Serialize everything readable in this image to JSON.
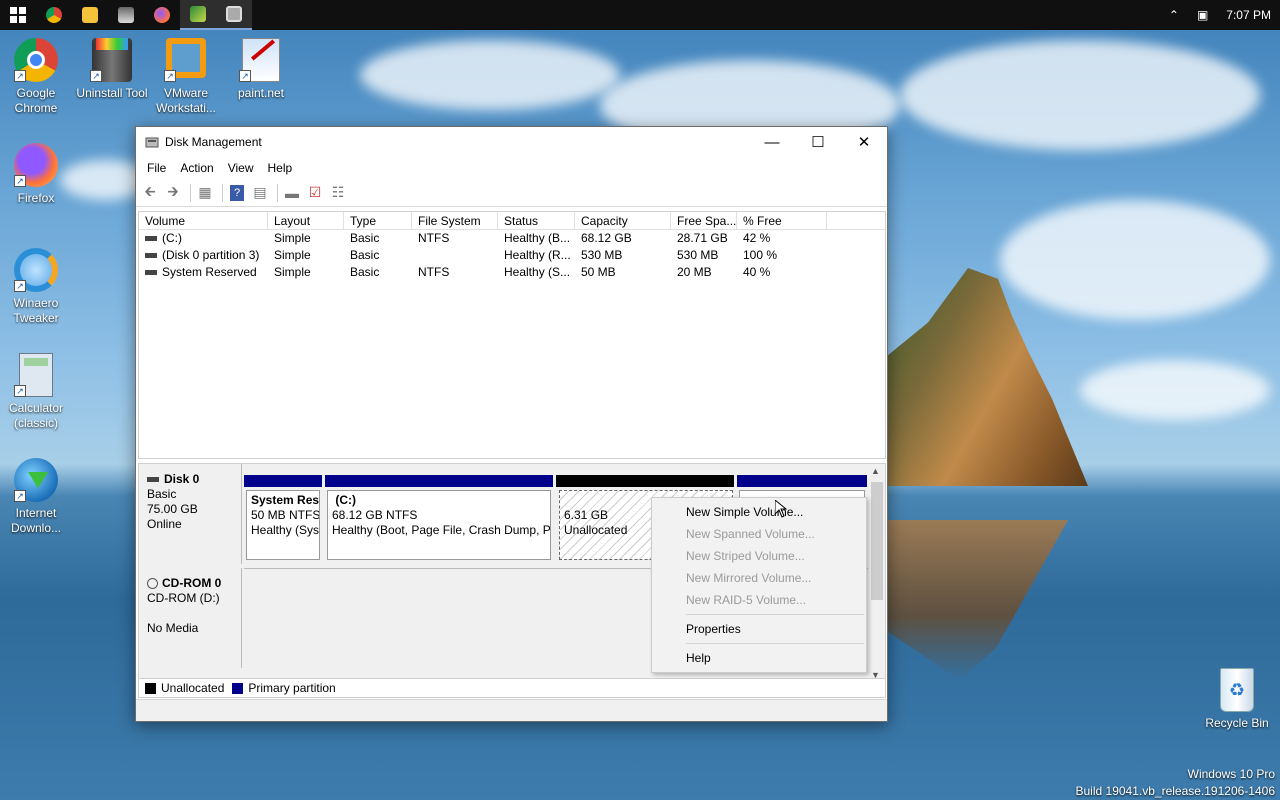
{
  "taskbar": {
    "apps": [
      {
        "icon": "windows-start-icon"
      },
      {
        "icon": "chrome-icon"
      },
      {
        "icon": "file-explorer-icon"
      },
      {
        "icon": "uninstall-tool-icon"
      },
      {
        "icon": "firefox-icon"
      },
      {
        "icon": "app-icon"
      },
      {
        "icon": "disk-management-icon"
      }
    ],
    "time": "7:07 PM"
  },
  "desktop": {
    "icons": [
      {
        "label": "Google Chrome",
        "icon": "chrome-icon"
      },
      {
        "label": "Uninstall Tool",
        "icon": "uninstall-tool-icon"
      },
      {
        "label": "VMware Workstati...",
        "icon": "vmware-icon"
      },
      {
        "label": "paint.net",
        "icon": "paintnet-icon"
      },
      {
        "label": "Firefox",
        "icon": "firefox-icon"
      },
      {
        "label": "Winaero Tweaker",
        "icon": "winaero-icon"
      },
      {
        "label": "Calculator (classic)",
        "icon": "calculator-icon"
      },
      {
        "label": "Internet Downlo...",
        "icon": "idm-icon"
      }
    ],
    "recycle_bin": "Recycle Bin",
    "watermark": {
      "line1": "Windows 10 Pro",
      "line2": "Build 19041.vb_release.191206-1406"
    }
  },
  "window": {
    "title": "Disk Management",
    "menu": [
      "File",
      "Action",
      "View",
      "Help"
    ],
    "columns": [
      "Volume",
      "Layout",
      "Type",
      "File System",
      "Status",
      "Capacity",
      "Free Spa...",
      "% Free"
    ],
    "rows": [
      [
        "(C:)",
        "Simple",
        "Basic",
        "NTFS",
        "Healthy (B...",
        "68.12 GB",
        "28.71 GB",
        "42 %"
      ],
      [
        "(Disk 0 partition 3)",
        "Simple",
        "Basic",
        "",
        "Healthy (R...",
        "530 MB",
        "530 MB",
        "100 %"
      ],
      [
        "System Reserved",
        "Simple",
        "Basic",
        "NTFS",
        "Healthy (S...",
        "50 MB",
        "20 MB",
        "40 %"
      ]
    ],
    "disk0": {
      "name": "Disk 0",
      "type": "Basic",
      "size": "75.00 GB",
      "state": "Online",
      "partitions": [
        {
          "name": "System Rese",
          "line2": "50 MB NTFS",
          "line3": "Healthy (Sys"
        },
        {
          "name": "(C:)",
          "line2": "68.12 GB NTFS",
          "line3": "Healthy (Boot, Page File, Crash Dump, Pr"
        },
        {
          "name": "",
          "line2": "6.31 GB",
          "line3": "Unallocated"
        }
      ]
    },
    "cdrom": {
      "name": "CD-ROM 0",
      "drive": "CD-ROM (D:)",
      "media": "No Media"
    },
    "legend": {
      "unallocated": "Unallocated",
      "primary": "Primary partition"
    },
    "colors": {
      "unallocated": "#000000",
      "primary": "#00008b"
    }
  },
  "context_menu": {
    "items": [
      {
        "label": "New Simple Volume...",
        "enabled": true
      },
      {
        "label": "New Spanned Volume...",
        "enabled": false
      },
      {
        "label": "New Striped Volume...",
        "enabled": false
      },
      {
        "label": "New Mirrored Volume...",
        "enabled": false
      },
      {
        "label": "New RAID-5 Volume...",
        "enabled": false
      },
      {
        "label": "Properties",
        "enabled": true
      },
      {
        "label": "Help",
        "enabled": true
      }
    ]
  }
}
